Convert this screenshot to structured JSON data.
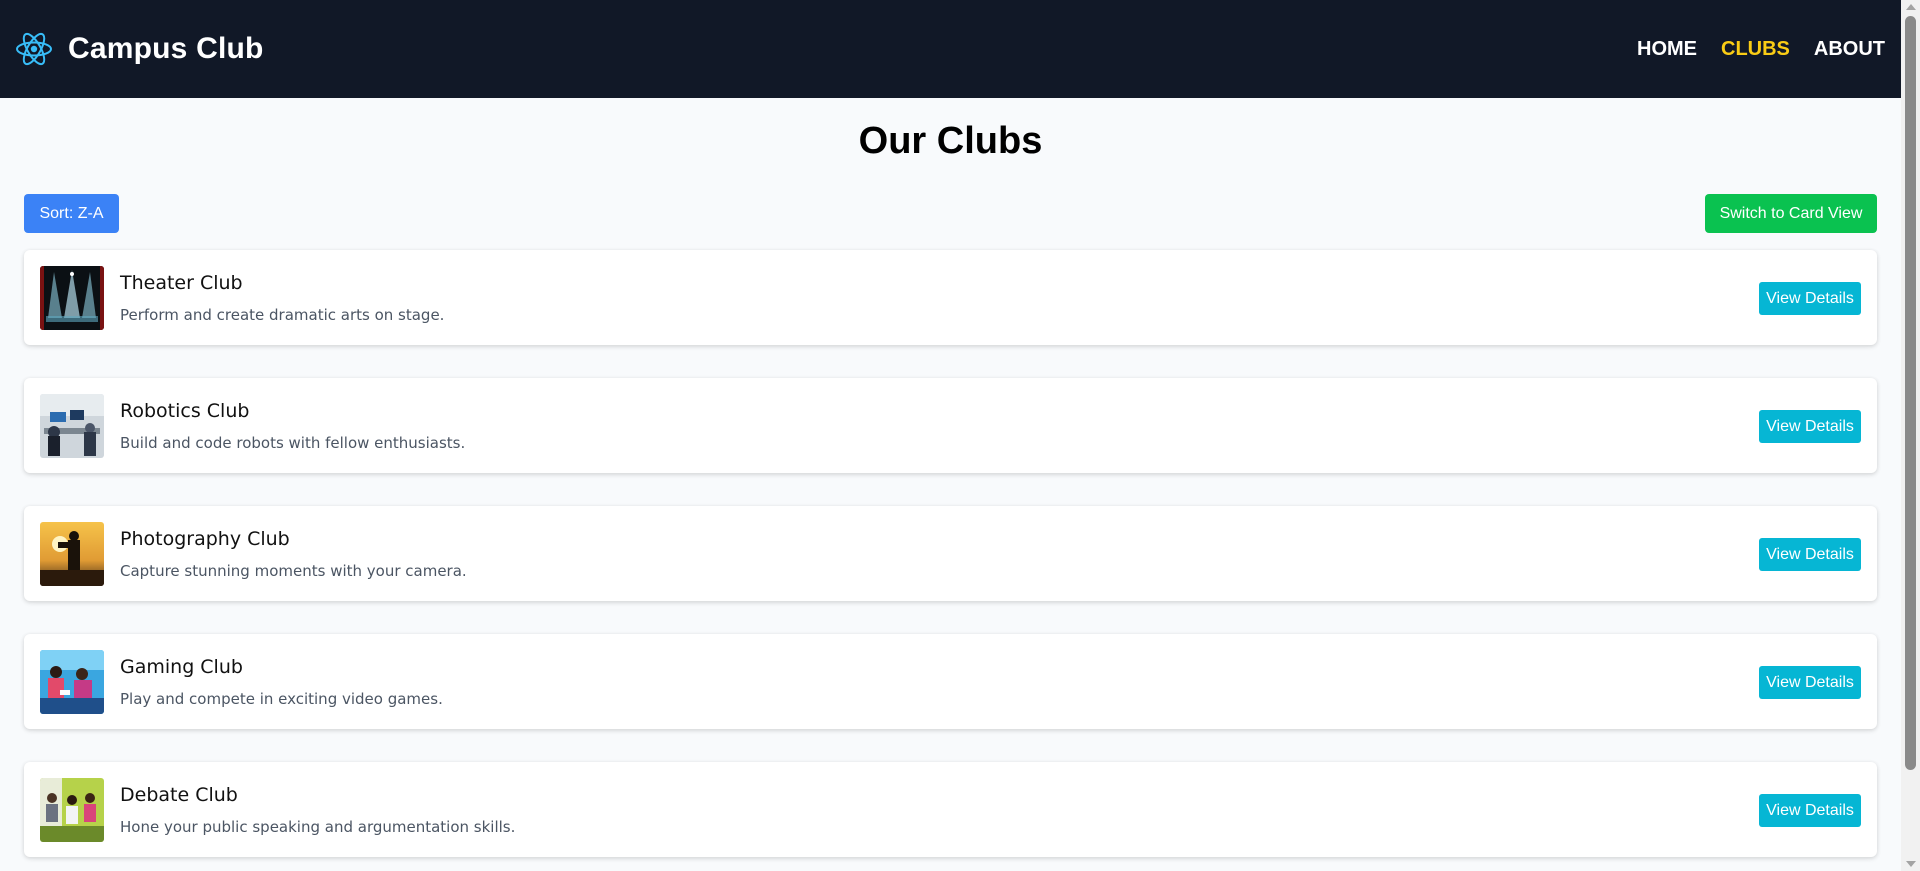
{
  "nav": {
    "brand": "Campus Club",
    "brand_icon": "react-atom-icon",
    "links": [
      {
        "label": "HOME",
        "active": false
      },
      {
        "label": "CLUBS",
        "active": true
      },
      {
        "label": "ABOUT",
        "active": false
      }
    ],
    "active_color": "#facc15",
    "bg_color": "#111827"
  },
  "page": {
    "title": "Our Clubs"
  },
  "toolbar": {
    "sort_label": "Sort: Z-A",
    "switch_label": "Switch to Card View",
    "sort_color": "#3b82f6",
    "switch_color": "#0ac250"
  },
  "clubs": [
    {
      "name": "Theater Club",
      "description": "Perform and create dramatic arts on stage.",
      "image": "stage-spotlights-image",
      "button": "View Details"
    },
    {
      "name": "Robotics Club",
      "description": "Build and code robots with fellow enthusiasts.",
      "image": "robotics-workshop-image",
      "button": "View Details"
    },
    {
      "name": "Photography Club",
      "description": "Capture stunning moments with your camera.",
      "image": "sunset-photographer-image",
      "button": "View Details"
    },
    {
      "name": "Gaming Club",
      "description": "Play and compete in exciting video games.",
      "image": "gamers-image",
      "button": "View Details"
    },
    {
      "name": "Debate Club",
      "description": "Hone your public speaking and argumentation skills.",
      "image": "debate-group-image",
      "button": "View Details"
    }
  ],
  "details_button_color": "#06b6d4"
}
